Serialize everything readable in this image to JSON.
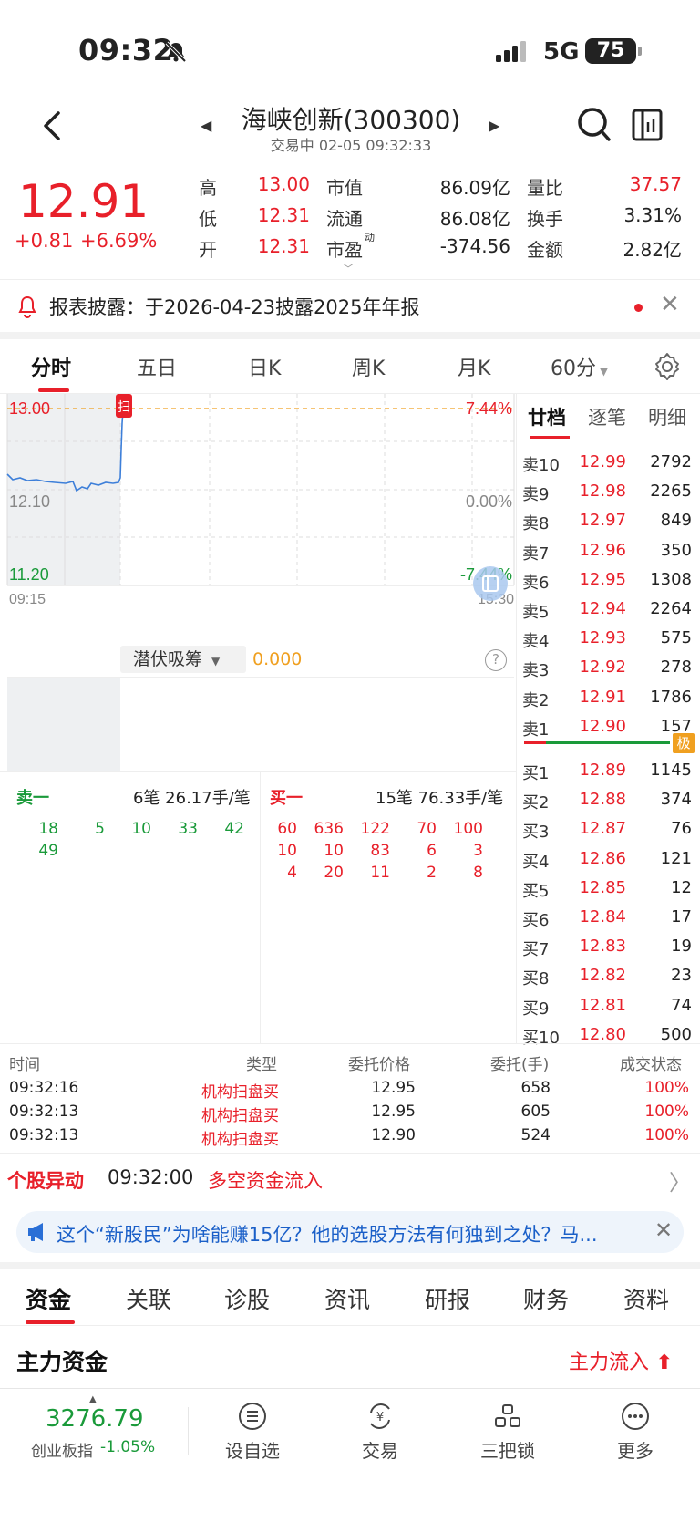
{
  "status": {
    "time": "09:32",
    "network": "5G",
    "battery": "75"
  },
  "header": {
    "title": "海峡创新(300300)",
    "subtitle": "交易中 02-05 09:32:33"
  },
  "quote": {
    "price": "12.91",
    "change": "+0.81",
    "change_pct": "+6.69%",
    "stats": [
      {
        "label": "高",
        "value": "13.00",
        "color": "red"
      },
      {
        "label": "低",
        "value": "12.31",
        "color": "red"
      },
      {
        "label": "开",
        "value": "12.31",
        "color": "red"
      },
      {
        "label": "市值",
        "value": "86.09亿",
        "color": "black"
      },
      {
        "label": "流通",
        "value": "86.08亿",
        "color": "black"
      },
      {
        "label": "市盈",
        "sup": "动",
        "value": "-374.56",
        "color": "black"
      },
      {
        "label": "量比",
        "value": "37.57",
        "color": "red"
      },
      {
        "label": "换手",
        "value": "3.31%",
        "color": "black"
      },
      {
        "label": "金额",
        "value": "2.82亿",
        "color": "black"
      }
    ]
  },
  "notice": {
    "text": "报表披露：于2026-04-23披露2025年年报"
  },
  "chart_tabs": [
    "分时",
    "五日",
    "日K",
    "周K",
    "月K",
    "60分"
  ],
  "chart": {
    "y_left": [
      "13.00",
      "12.10",
      "11.20"
    ],
    "y_right": [
      "7.44%",
      "0.00%",
      "-7.44%"
    ],
    "x_start": "09:15",
    "x_end": "15:30",
    "marker": "扫",
    "line_color": "#3d7fd9"
  },
  "indicator": {
    "name": "潜伏吸筹",
    "value": "0.000",
    "help": "?"
  },
  "side_tabs": [
    "廿档",
    "逐笔",
    "明细"
  ],
  "order_book": {
    "sell": [
      {
        "label": "卖10",
        "price": "12.99",
        "vol": "2792"
      },
      {
        "label": "卖9",
        "price": "12.98",
        "vol": "2265"
      },
      {
        "label": "卖8",
        "price": "12.97",
        "vol": "849"
      },
      {
        "label": "卖7",
        "price": "12.96",
        "vol": "350"
      },
      {
        "label": "卖6",
        "price": "12.95",
        "vol": "1308"
      },
      {
        "label": "卖5",
        "price": "12.94",
        "vol": "2264"
      },
      {
        "label": "卖4",
        "price": "12.93",
        "vol": "575"
      },
      {
        "label": "卖3",
        "price": "12.92",
        "vol": "278"
      },
      {
        "label": "卖2",
        "price": "12.91",
        "vol": "1786"
      },
      {
        "label": "卖1",
        "price": "12.90",
        "vol": "157"
      }
    ],
    "tag": "极",
    "buy": [
      {
        "label": "买1",
        "price": "12.89",
        "vol": "1145"
      },
      {
        "label": "买2",
        "price": "12.88",
        "vol": "374"
      },
      {
        "label": "买3",
        "price": "12.87",
        "vol": "76"
      },
      {
        "label": "买4",
        "price": "12.86",
        "vol": "121"
      },
      {
        "label": "买5",
        "price": "12.85",
        "vol": "12"
      },
      {
        "label": "买6",
        "price": "12.84",
        "vol": "17"
      },
      {
        "label": "买7",
        "price": "12.83",
        "vol": "19"
      },
      {
        "label": "买8",
        "price": "12.82",
        "vol": "23"
      },
      {
        "label": "买9",
        "price": "12.81",
        "vol": "74"
      },
      {
        "label": "买10",
        "price": "12.80",
        "vol": "500"
      }
    ]
  },
  "queues": {
    "sell": {
      "title": "卖一",
      "info": "6笔 26.17手/笔",
      "orders": [
        "18",
        "5",
        "10",
        "33",
        "42",
        "49"
      ]
    },
    "buy": {
      "title": "买一",
      "info": "15笔 76.33手/笔",
      "orders": [
        "60",
        "636",
        "122",
        "70",
        "100",
        "10",
        "10",
        "83",
        "6",
        "3",
        "4",
        "20",
        "11",
        "2",
        "8"
      ]
    }
  },
  "orders_table": {
    "headers": [
      "时间",
      "类型",
      "委托价格",
      "委托(手)",
      "成交状态"
    ],
    "rows": [
      [
        "09:32:16",
        "机构扫盘买",
        "12.95",
        "658",
        "100%"
      ],
      [
        "09:32:13",
        "机构扫盘买",
        "12.95",
        "605",
        "100%"
      ],
      [
        "09:32:13",
        "机构扫盘买",
        "12.90",
        "524",
        "100%"
      ]
    ]
  },
  "alert": {
    "title": "个股异动",
    "time": "09:32:00",
    "event": "多空资金流入"
  },
  "news": {
    "text": "这个“新股民”为啥能赚15亿？他的选股方法有何独到之处？马..."
  },
  "bottom_tabs": [
    "资金",
    "关联",
    "诊股",
    "资讯",
    "研报",
    "财务",
    "资料"
  ],
  "main_fund": {
    "title": "主力资金",
    "flow": "主力流入"
  },
  "bottom_bar": {
    "index_value": "3276.79",
    "index_name": "创业板指",
    "index_change": "-1.05%",
    "buttons": [
      "设自选",
      "交易",
      "三把锁",
      "更多"
    ]
  },
  "colors": {
    "red": "#e8202a",
    "green": "#1a9a3a",
    "blue": "#3d7fd9",
    "orange": "#f0a020"
  }
}
